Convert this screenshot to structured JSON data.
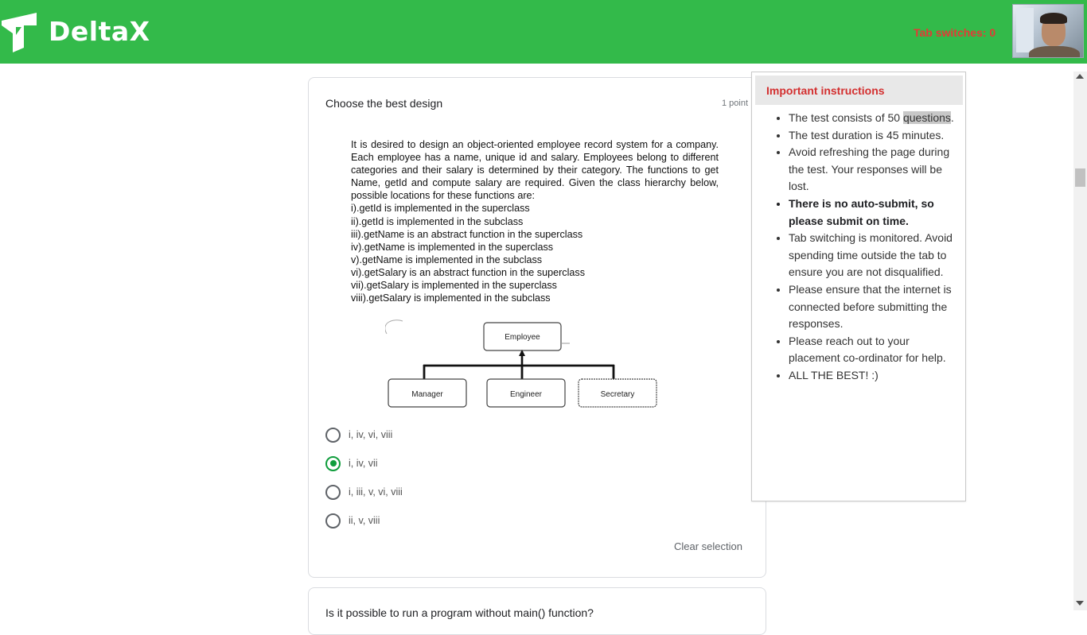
{
  "header": {
    "brand": "DeltaX",
    "tab_switches": "Tab switches: 0",
    "logo_icon": "deltax-logo-icon",
    "bg_color": "#33ba4a"
  },
  "question": {
    "title": "Choose the best design",
    "points": "1 point",
    "paragraph": "It is desired to design an object-oriented employee record system for a company. Each employee has a name, unique id and salary. Employees belong to different categories and their salary is determined by their category. The functions to get Name, getId and compute salary are required. Given the class hierarchy below, possible locations for these functions are:",
    "items": [
      "i).getId is implemented in the superclass",
      "ii).getId is implemented in the subclass",
      "iii).getName is an abstract function in the superclass",
      "iv).getName is implemented in the superclass",
      "v).getName is implemented in the subclass",
      "vi).getSalary is an abstract function in the superclass",
      "vii).getSalary is implemented in the superclass",
      "viii).getSalary is implemented in the subclass"
    ],
    "diagram": {
      "root": "Employee",
      "children": [
        "Manager",
        "Engineer",
        "Secretary"
      ]
    },
    "options": [
      {
        "label": "i, iv, vi, viii",
        "selected": false
      },
      {
        "label": "i, iv, vii",
        "selected": true
      },
      {
        "label": "i, iii, v, vi, viii",
        "selected": false
      },
      {
        "label": "ii, v, viii",
        "selected": false
      }
    ],
    "clear_label": "Clear selection",
    "accent_color": "#0f9d3c"
  },
  "next_question": {
    "title": "Is it possible to run a program without main() function?"
  },
  "instructions": {
    "title": "Important instructions",
    "items": [
      {
        "before": "The test consists of 50 ",
        "highlight": "questions",
        "after": ".",
        "bold": false
      },
      {
        "before": "The test duration is 45 minutes.",
        "highlight": "",
        "after": "",
        "bold": false
      },
      {
        "before": "Avoid refreshing the page during the test. Your responses will be lost.",
        "highlight": "",
        "after": "",
        "bold": false
      },
      {
        "before": "There is no auto-submit, so please submit on time.",
        "highlight": "",
        "after": "",
        "bold": true
      },
      {
        "before": "Tab switching is monitored. Avoid spending time outside the tab to ensure you are not disqualified.",
        "highlight": "",
        "after": "",
        "bold": false
      },
      {
        "before": "Please ensure that the internet is connected before submitting the responses.",
        "highlight": "",
        "after": "",
        "bold": false
      },
      {
        "before": "Please reach out to your placement co-ordinator for help.",
        "highlight": "",
        "after": "",
        "bold": false
      },
      {
        "before": "ALL THE BEST! :)",
        "highlight": "",
        "after": "",
        "bold": false
      }
    ]
  }
}
